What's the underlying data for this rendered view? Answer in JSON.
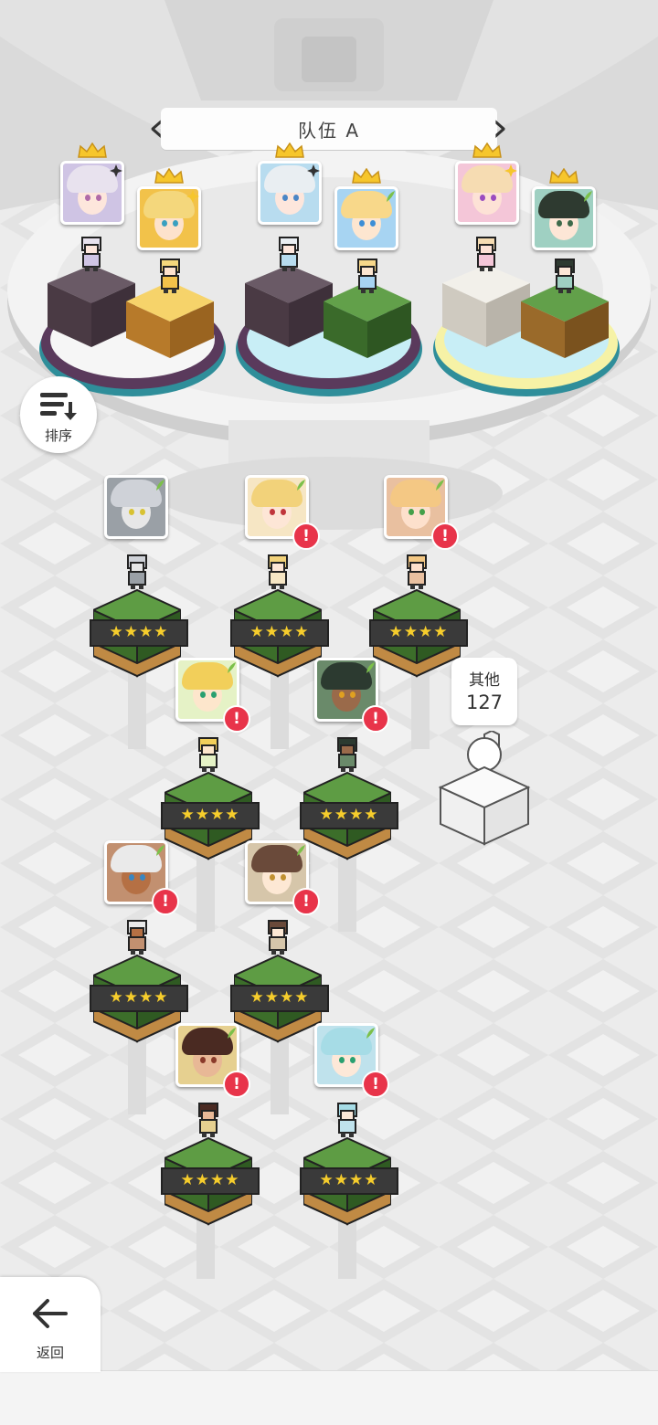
{
  "team": {
    "title": "队伍 A"
  },
  "sort_button": {
    "label": "排序"
  },
  "back_button": {
    "label": "返回"
  },
  "other_units": {
    "label": "其他",
    "count": "127"
  },
  "team_slots": [
    {
      "hair": "#e8e2ee",
      "skin": "#fde6dc",
      "eye": "#b06aa8",
      "bg": "#cfc4e4",
      "elem": "dark",
      "crown": true
    },
    {
      "hair": "#f4d77c",
      "skin": "#fde2cc",
      "eye": "#3aa0c0",
      "bg": "#f2c24a",
      "elem": "light",
      "crown": true
    },
    {
      "hair": "#e9eef2",
      "skin": "#fde6dc",
      "eye": "#4a86c6",
      "bg": "#b8dcef",
      "elem": "dark",
      "crown": true
    },
    {
      "hair": "#f8d88a",
      "skin": "#fde6d0",
      "eye": "#3c8ed6",
      "bg": "#a7d4f2",
      "elem": "wind",
      "crown": true
    },
    {
      "hair": "#f6dcb2",
      "skin": "#fde2d6",
      "eye": "#9a4cc0",
      "bg": "#f4c6d8",
      "elem": "light",
      "crown": true
    },
    {
      "hair": "#2e3a30",
      "skin": "#fde6d6",
      "eye": "#3d6a4a",
      "bg": "#9fd0c2",
      "elem": "wind",
      "crown": true
    }
  ],
  "roster": [
    {
      "hair": "#cfd2d8",
      "skin": "#e7e7e7",
      "eye": "#d8c232",
      "bg": "#9aa0a6",
      "stars": "★★★★",
      "alert": false
    },
    {
      "hair": "#f2d27a",
      "skin": "#fde6d6",
      "eye": "#c0353b",
      "bg": "#f6e6c4",
      "stars": "★★★★",
      "alert": true
    },
    {
      "hair": "#f4c884",
      "skin": "#fde0cc",
      "eye": "#44a04a",
      "bg": "#e9c0a0",
      "stars": "★★★★",
      "alert": true
    },
    {
      "hair": "#f2cf5a",
      "skin": "#fde6cc",
      "eye": "#2aa070",
      "bg": "#e5f2c6",
      "stars": "★★★★",
      "alert": true
    },
    {
      "hair": "#2c3a30",
      "skin": "#9a6a4a",
      "eye": "#e0a020",
      "bg": "#6a8a6a",
      "stars": "★★★★",
      "alert": true
    },
    {
      "hair": "#eaeaea",
      "skin": "#b57044",
      "eye": "#3a86c0",
      "bg": "#c29070",
      "stars": "★★★★",
      "alert": true
    },
    {
      "hair": "#6a4a3a",
      "skin": "#fde8d4",
      "eye": "#c09030",
      "bg": "#d6c6aa",
      "stars": "★★★★",
      "alert": true
    },
    {
      "hair": "#4a2a22",
      "skin": "#e8b896",
      "eye": "#8a3a2a",
      "bg": "#e6d090",
      "stars": "★★★★",
      "alert": true
    },
    {
      "hair": "#a6dce6",
      "skin": "#fde8d8",
      "eye": "#2aa070",
      "bg": "#bfe2ec",
      "stars": "★★★★",
      "alert": true
    }
  ]
}
